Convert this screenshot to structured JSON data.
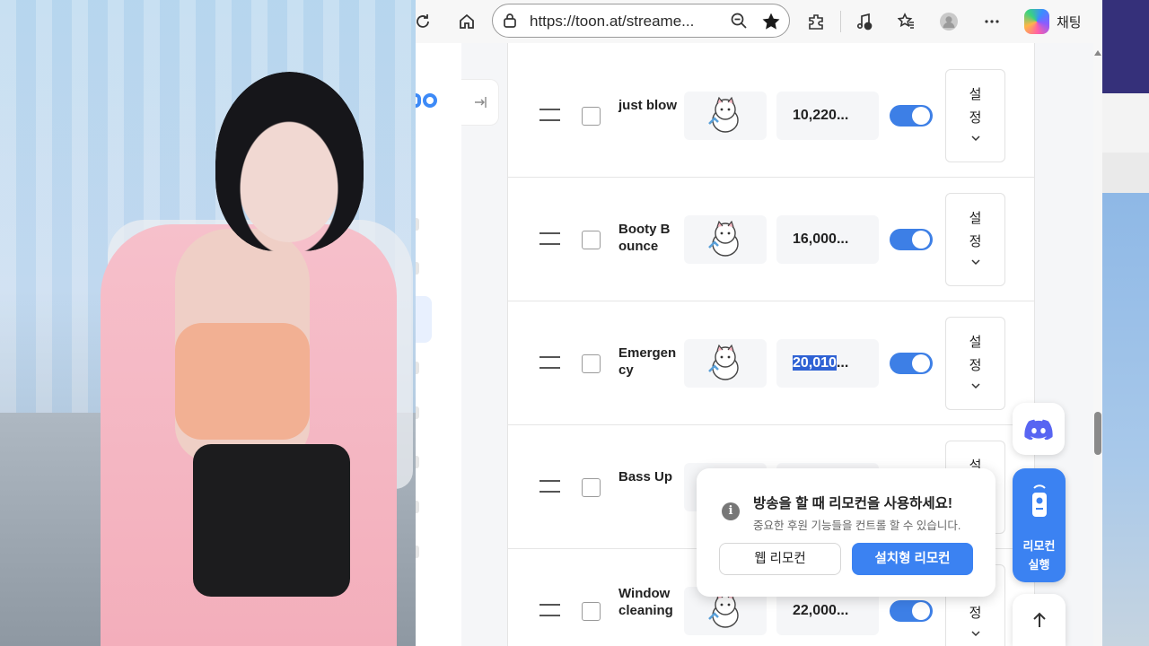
{
  "browser": {
    "url": "https://toon.at/streame...",
    "copilot_label": "채팅"
  },
  "donation_items": [
    {
      "name": "just blow",
      "amount": "10,220...",
      "amount_selected": "",
      "enabled": true,
      "settings_line1": "설",
      "settings_line2": "정"
    },
    {
      "name": "Booty Bounce",
      "amount": "16,000...",
      "amount_selected": "",
      "enabled": true,
      "settings_line1": "설",
      "settings_line2": "정"
    },
    {
      "name": "Emergency",
      "amount": "...",
      "amount_selected": "20,010",
      "enabled": true,
      "settings_line1": "설",
      "settings_line2": "정"
    },
    {
      "name": "Bass Up",
      "amount": "",
      "amount_selected": "",
      "enabled": true,
      "settings_line1": "설",
      "settings_line2": ""
    },
    {
      "name": "Window cleaning",
      "amount": "22,000...",
      "amount_selected": "",
      "enabled": true,
      "settings_line1": "",
      "settings_line2": "정"
    }
  ],
  "popup": {
    "title": "방송을 할 때 리모컨을 사용하세요!",
    "description": "중요한 후원 기능들을 컨트롤 할 수 있습니다.",
    "web_remote_label": "웹 리모컨",
    "installed_remote_label": "설치형 리모컨"
  },
  "remote_button": {
    "line1": "리모컨",
    "line2": "실행"
  },
  "colors": {
    "accent": "#3b82f2",
    "discord": "#5865f2",
    "selection": "#2f62d4"
  },
  "icons": [
    "refresh-icon",
    "home-icon",
    "lock-icon",
    "zoom-out-icon",
    "star-icon",
    "extensions-icon",
    "media-icon",
    "favorites-icon",
    "profile-icon",
    "more-icon",
    "copilot-icon",
    "collapse-icon",
    "drag-handle-icon",
    "mascot-icon",
    "chevron-down-icon",
    "discord-icon",
    "remote-icon",
    "info-icon",
    "arrow-up-icon"
  ]
}
